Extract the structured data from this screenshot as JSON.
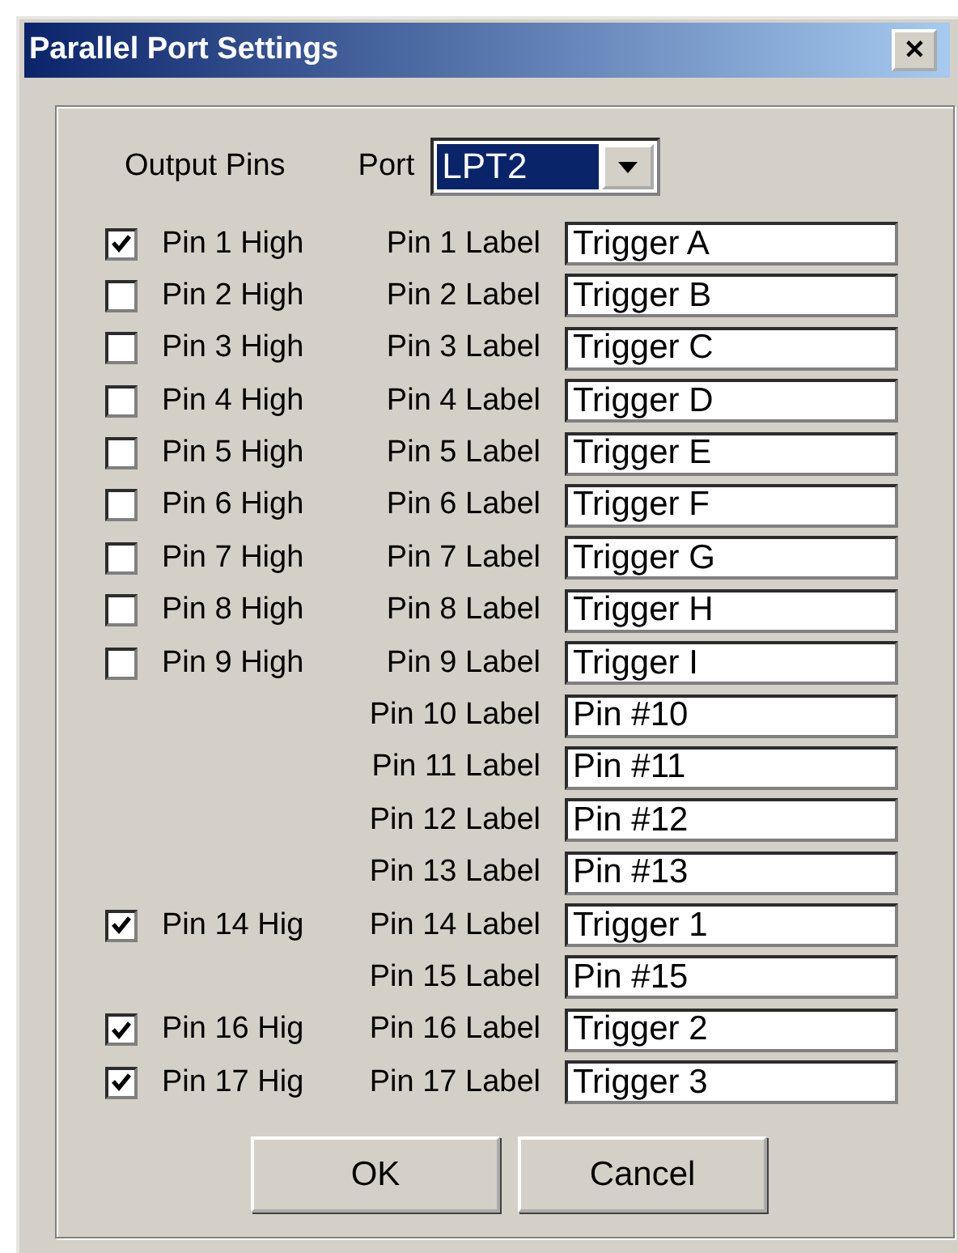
{
  "window": {
    "title": "Parallel Port Settings",
    "close": "✕"
  },
  "header": {
    "output_pins": "Output Pins",
    "port_label": "Port",
    "port_value": "LPT2"
  },
  "pins": [
    {
      "kind": "checkbox",
      "output": "Pin 1 High",
      "checked": true,
      "caption": "Pin 1 Label",
      "value": "Trigger A"
    },
    {
      "kind": "checkbox",
      "output": "Pin 2 High",
      "checked": false,
      "caption": "Pin 2 Label",
      "value": "Trigger B"
    },
    {
      "kind": "checkbox",
      "output": "Pin 3 High",
      "checked": false,
      "caption": "Pin 3 Label",
      "value": "Trigger C"
    },
    {
      "kind": "checkbox",
      "output": "Pin 4 High",
      "checked": false,
      "caption": "Pin 4 Label",
      "value": "Trigger D"
    },
    {
      "kind": "checkbox",
      "output": "Pin 5 High",
      "checked": false,
      "caption": "Pin 5 Label",
      "value": "Trigger E"
    },
    {
      "kind": "checkbox",
      "output": "Pin 6 High",
      "checked": false,
      "caption": "Pin 6 Label",
      "value": "Trigger F"
    },
    {
      "kind": "checkbox",
      "output": "Pin 7 High",
      "checked": false,
      "caption": "Pin 7 Label",
      "value": "Trigger G"
    },
    {
      "kind": "checkbox",
      "output": "Pin 8 High",
      "checked": false,
      "caption": "Pin 8 Label",
      "value": "Trigger H"
    },
    {
      "kind": "checkbox",
      "output": "Pin 9 High",
      "checked": false,
      "caption": "Pin 9 Label",
      "value": "Trigger I"
    },
    {
      "kind": "label",
      "caption": "Pin 10 Label",
      "value": "Pin #10"
    },
    {
      "kind": "label",
      "caption": "Pin 11 Label",
      "value": "Pin #11"
    },
    {
      "kind": "label",
      "caption": "Pin 12 Label",
      "value": "Pin #12"
    },
    {
      "kind": "label",
      "caption": "Pin 13 Label",
      "value": "Pin #13"
    },
    {
      "kind": "checkbox",
      "output": "Pin 14 Hig",
      "checked": true,
      "caption": "Pin 14 Label",
      "value": "Trigger 1"
    },
    {
      "kind": "label",
      "caption": "Pin 15 Label",
      "value": "Pin #15"
    },
    {
      "kind": "checkbox",
      "output": "Pin 16 Hig",
      "checked": true,
      "caption": "Pin 16 Label",
      "value": "Trigger 2"
    },
    {
      "kind": "checkbox",
      "output": "Pin 17 Hig",
      "checked": true,
      "caption": "Pin 17 Label",
      "value": "Trigger 3"
    }
  ],
  "buttons": [
    "OK",
    "Cancel"
  ]
}
